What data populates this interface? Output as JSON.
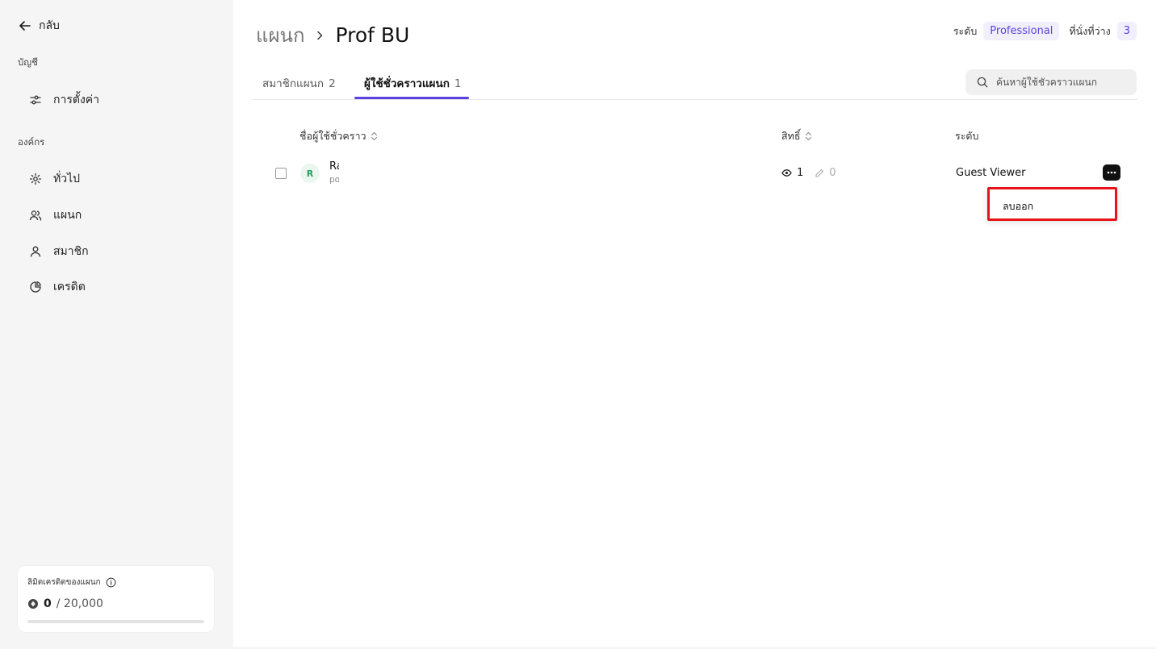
{
  "sidebar": {
    "back_label": "กลับ",
    "account_section": "บัญชี",
    "settings_label": "การตั้งค่า",
    "org_section": "องค์กร",
    "items": [
      {
        "label": "ทั่วไป",
        "icon": "gear-icon"
      },
      {
        "label": "แผนก",
        "icon": "users-icon"
      },
      {
        "label": "สมาชิก",
        "icon": "user-icon"
      },
      {
        "label": "เครดิต",
        "icon": "pie-chart-icon"
      }
    ],
    "credit": {
      "title": "ลิมิตเครดิตของแผนก",
      "used": "0",
      "total": "/ 20,000",
      "progress_fraction": 0
    }
  },
  "header": {
    "breadcrumb_parent": "แผนก",
    "breadcrumb_current": "Prof BU",
    "level_label": "ระดับ",
    "level_value": "Professional",
    "seats_label": "ที่นั่งที่ว่าง",
    "seats_value": "3"
  },
  "tabs": [
    {
      "label": "สมาชิกแผนก",
      "count": "2",
      "active": false
    },
    {
      "label": "ผู้ใช้ชั่วคราวแผนก",
      "count": "1",
      "active": true
    }
  ],
  "search": {
    "placeholder": "ค้นหาผู้ใช้ชั่วคราวแผนก"
  },
  "table": {
    "columns": {
      "name": "ชื่อผู้ใช้ชั่วคราว",
      "permission": "สิทธิ์",
      "level": "ระดับ"
    },
    "rows": [
      {
        "initial": "R",
        "name": "Ra",
        "email": "po",
        "view_count": "1",
        "edit_count": "0",
        "level": "Guest Viewer"
      }
    ]
  },
  "row_menu": {
    "remove_label": "ลบออก"
  },
  "colors": {
    "accent": "#5b3fe0",
    "highlight_border": "#e8141c",
    "avatar_green": "#2a9d5c"
  }
}
